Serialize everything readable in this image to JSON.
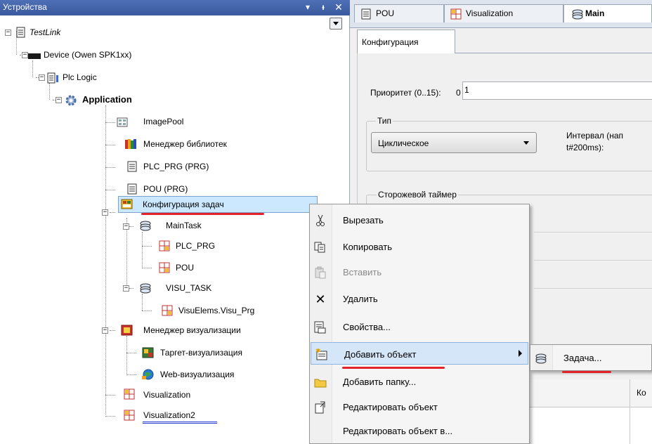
{
  "devices_panel": {
    "title": "Устройства",
    "pin_icon": "pin-icon",
    "close_icon": "close-icon",
    "dropdown_icon": "chevron-down-icon"
  },
  "tree": {
    "testlink": "TestLink",
    "device": "Device (Owen SPK1xx)",
    "plc_logic": "Plc Logic",
    "application": "Application",
    "image_pool": "ImagePool",
    "library_manager": "Менеджер библиотек",
    "plc_prg": "PLC_PRG (PRG)",
    "pou": "POU (PRG)",
    "task_config": "Конфигурация задач",
    "main_task": "MainTask",
    "main_plc_prg": "PLC_PRG",
    "main_pou": "POU",
    "visu_task": "VISU_TASK",
    "visu_prg": "VisuElems.Visu_Prg",
    "visu_manager": "Менеджер визуализации",
    "target_visu": "Таргет-визуализация",
    "web_visu": "Web-визуализация",
    "visualization": "Visualization",
    "visualization2": "Visualization2"
  },
  "editor": {
    "tabs": [
      "POU",
      "Visualization",
      "Main"
    ],
    "subtab": "Конфигурация",
    "priority_label": "Приоритет (0..15):",
    "priority_value": "1",
    "priority_prefix": "0",
    "type_label": "Тип",
    "type_value": "Циклическое",
    "interval_label_1": "Интервал (нап",
    "interval_label_2": "t#200ms):",
    "watchdog_label": "Сторожевой таймер",
    "table_header": "Ко"
  },
  "context_menu": {
    "items": [
      {
        "label": "Вырезать",
        "icon": "scissors-icon"
      },
      {
        "label": "Копировать",
        "icon": "copy-icon"
      },
      {
        "label": "Вставить",
        "icon": "paste-icon"
      },
      {
        "label": "Удалить",
        "icon": "delete-icon"
      },
      {
        "label": "Свойства...",
        "icon": "properties-icon"
      },
      {
        "label": "Добавить объект",
        "icon": "add-object-icon"
      },
      {
        "label": "Добавить папку...",
        "icon": "folder-icon"
      },
      {
        "label": "Редактировать объект",
        "icon": "edit-object-icon"
      },
      {
        "label": "Редактировать объект в...",
        "icon": ""
      }
    ],
    "submenu_label": "Задача..."
  },
  "colors": {
    "header_blue": "#3f5fa8",
    "selection": "#cce8ff",
    "underline_red": "#e3232a",
    "underline_blue": "#2b3ed8"
  }
}
